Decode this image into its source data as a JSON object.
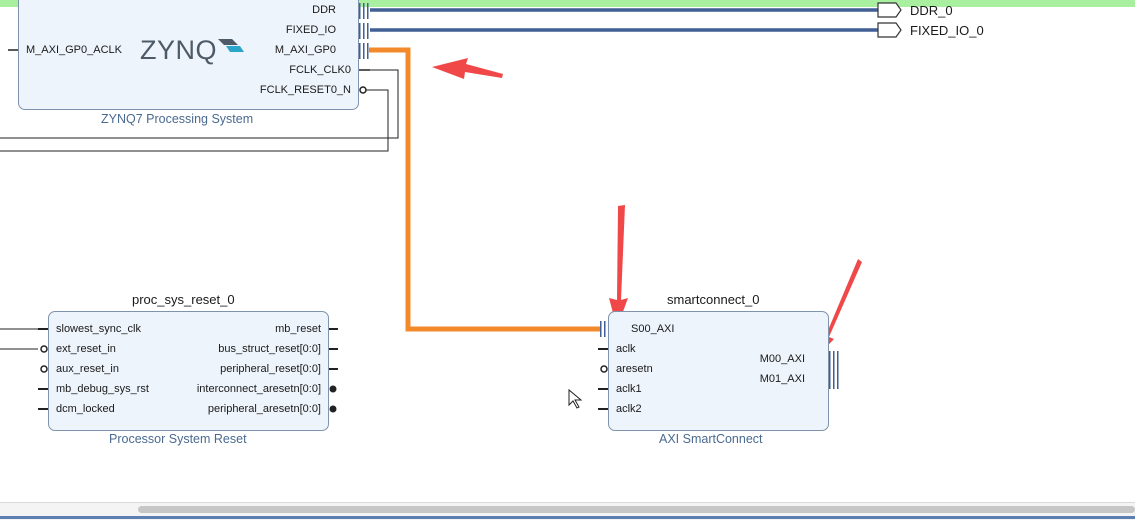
{
  "zynq": {
    "logo": "ZYNQ",
    "subtitle": "ZYNQ7 Processing System",
    "left_port": "M_AXI_GP0_ACLK",
    "right_ports": [
      "DDR",
      "FIXED_IO",
      "M_AXI_GP0",
      "FCLK_CLK0",
      "FCLK_RESET0_N"
    ]
  },
  "external_ports": [
    "DDR_0",
    "FIXED_IO_0"
  ],
  "proc_sys_reset": {
    "title": "proc_sys_reset_0",
    "subtitle": "Processor System Reset",
    "left_ports": [
      "slowest_sync_clk",
      "ext_reset_in",
      "aux_reset_in",
      "mb_debug_sys_rst",
      "dcm_locked"
    ],
    "right_ports": [
      "mb_reset",
      "bus_struct_reset[0:0]",
      "peripheral_reset[0:0]",
      "interconnect_aresetn[0:0]",
      "peripheral_aresetn[0:0]"
    ]
  },
  "smartconnect": {
    "title": "smartconnect_0",
    "subtitle": "AXI SmartConnect",
    "left_ports": [
      "S00_AXI",
      "aclk",
      "aresetn",
      "aclk1",
      "aclk2"
    ],
    "right_ports": [
      "M00_AXI",
      "M01_AXI"
    ]
  },
  "colors": {
    "block_fill": "#eef4fb",
    "block_border": "#7f93ad",
    "bus_wire": "#3f5f95",
    "axi_wire": "#f28a2c",
    "annotation_arrow": "#f04848",
    "top_bar": "#a8f0a0"
  }
}
